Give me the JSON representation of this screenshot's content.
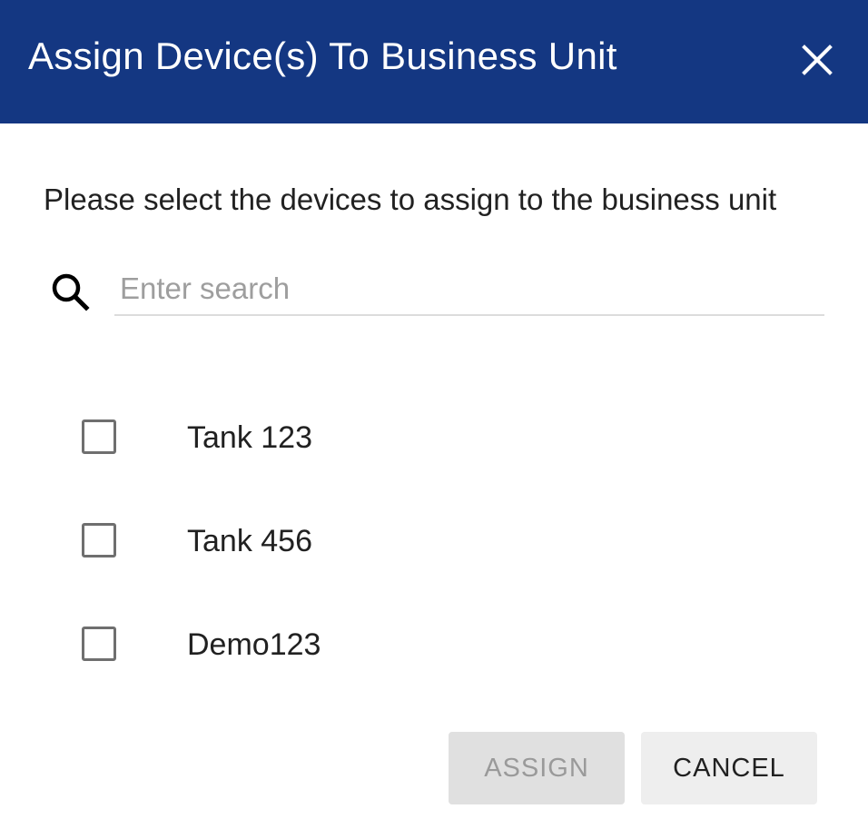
{
  "dialog": {
    "title": "Assign Device(s) To Business Unit",
    "close_icon": "close-icon",
    "header_color": "#143782"
  },
  "instruction": "Please select the devices to assign to the business unit",
  "search": {
    "icon": "search-icon",
    "placeholder": "Enter search",
    "value": ""
  },
  "devices": [
    {
      "label": "Tank 123",
      "checked": false
    },
    {
      "label": "Tank 456",
      "checked": false
    },
    {
      "label": "Demo123",
      "checked": false
    }
  ],
  "actions": {
    "assign_label": "ASSIGN",
    "assign_disabled": true,
    "cancel_label": "CANCEL"
  }
}
